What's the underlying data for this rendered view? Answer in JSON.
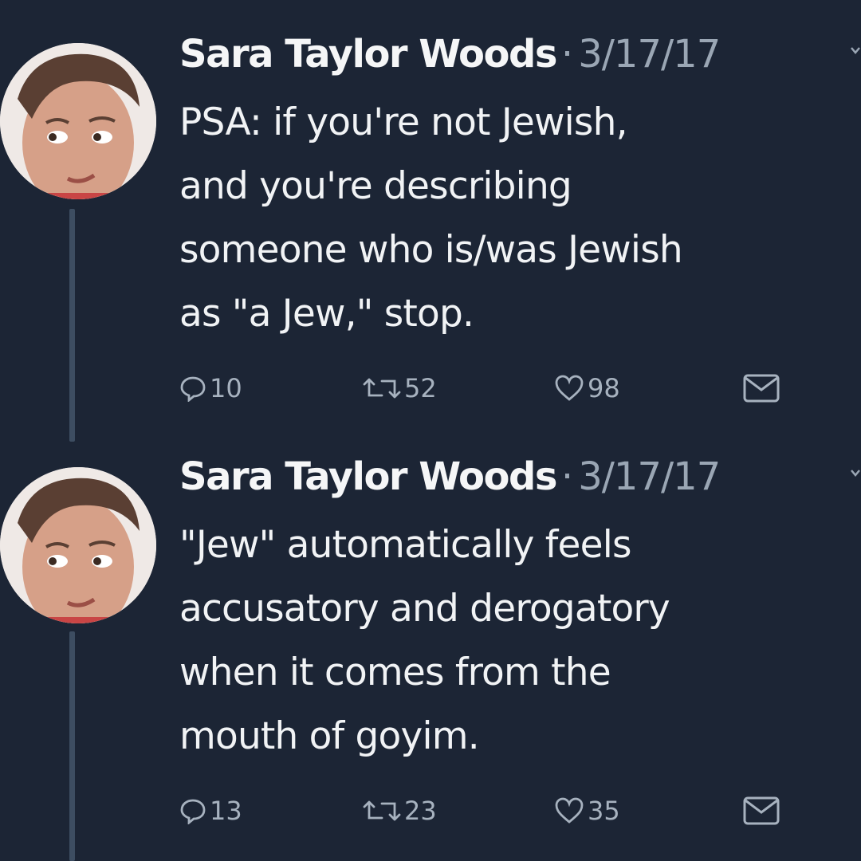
{
  "tweets": [
    {
      "author": "Sara Taylor Woods",
      "separator": "·",
      "date": "3/17/17",
      "lines": [
        "PSA: if you're not Jewish,",
        "and you're describing",
        "someone who is/was Jewish",
        "as \"a Jew,\" stop."
      ],
      "replies": "10",
      "retweets": "52",
      "likes": "98"
    },
    {
      "author": "Sara Taylor Woods",
      "separator": "·",
      "date": "3/17/17",
      "lines": [
        "\"Jew\" automatically feels",
        "accusatory and derogatory",
        "when it comes from the",
        "mouth of goyim."
      ],
      "replies": "13",
      "retweets": "23",
      "likes": "35"
    }
  ],
  "colors": {
    "background": "#1c2535",
    "text": "#f1f3f5",
    "muted": "#9aa6b4",
    "thread_line": "#3d4d61"
  },
  "icons": [
    "reply-icon",
    "retweet-icon",
    "like-icon",
    "direct-message-icon",
    "chevron-down-icon"
  ]
}
